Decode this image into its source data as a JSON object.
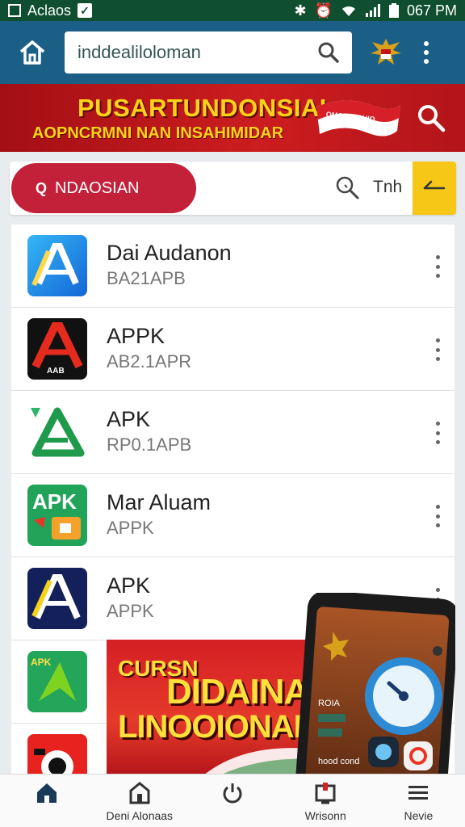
{
  "status_bar": {
    "left_text": "Aclaos",
    "time": "067 PM"
  },
  "app_bar": {
    "search_value": "inddealiloloman"
  },
  "banner": {
    "title": "PUSARTUNDONSIAI",
    "subtitle": "AOPNCRMNI NAN INSAHIMIDAR",
    "ribbon_text": "OMOIOOOHIO"
  },
  "filter": {
    "chip_glyph": "Q",
    "chip_label": "NDAOSIAN",
    "search_text": "Tnh"
  },
  "apps": [
    {
      "title": "Dai Audanon",
      "subtitle": "BA21APB",
      "icon": "app-store-a-icon"
    },
    {
      "title": "APPK",
      "subtitle": "AB2.1APR",
      "icon": "red-a-icon",
      "icon_text": "AAB"
    },
    {
      "title": "APK",
      "subtitle": "RP0.1APB",
      "icon": "green-triangle-icon"
    },
    {
      "title": "Mar Aluam",
      "subtitle": "APPK",
      "icon": "apk-tag-icon",
      "icon_text": "APK"
    },
    {
      "title": "APK",
      "subtitle": "APPK",
      "icon": "navy-a-icon"
    },
    {
      "title": "",
      "subtitle": "",
      "icon": "green-arrow-icon",
      "icon_text": "APK"
    },
    {
      "title": "",
      "subtitle": "",
      "icon": "red-camera-icon"
    }
  ],
  "promo": {
    "small": "CURSN",
    "line1": "DIDAINAN",
    "line2": "LINOOIONAN"
  },
  "phone": {
    "caption": "ROIA",
    "footer": "hood cond"
  },
  "bottom_nav": [
    {
      "label": "",
      "icon": "home-icon"
    },
    {
      "label": "Deni Alonaas",
      "icon": "building-icon"
    },
    {
      "label": "",
      "icon": "power-icon"
    },
    {
      "label": "Wrisonn",
      "icon": "box-icon"
    },
    {
      "label": "Nevie",
      "icon": "menu-icon"
    }
  ],
  "colors": {
    "status": "#0f4f2f",
    "appbar": "#1b5e86",
    "banner_red": "#b3141a",
    "chip": "#c3213a",
    "accent_yellow": "#f6c716"
  }
}
